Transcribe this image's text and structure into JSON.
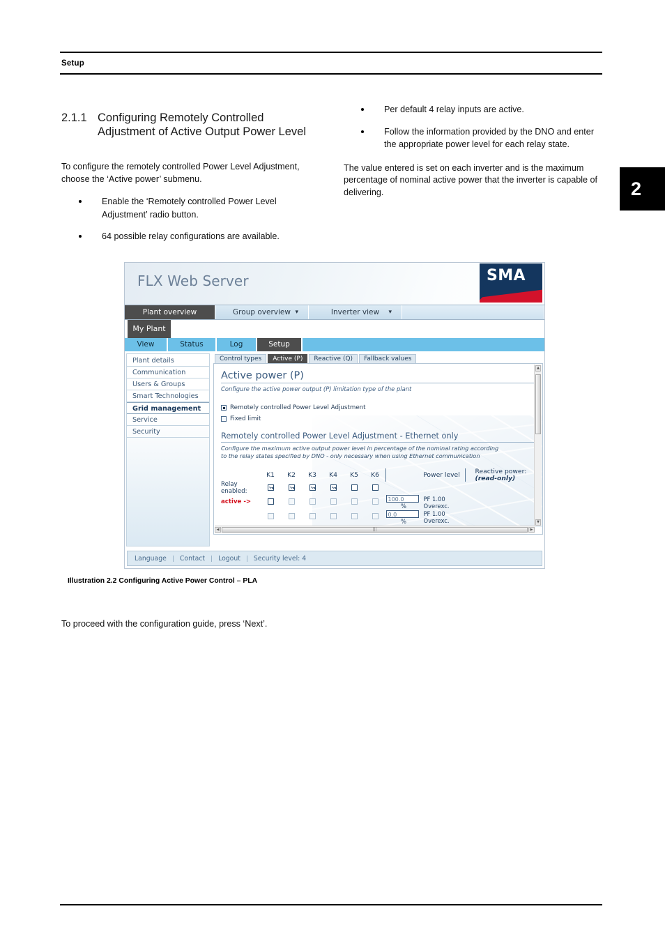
{
  "page": {
    "running_head": "Setup",
    "chapter_marker": "2"
  },
  "section": {
    "number": "2.1.1",
    "title": "Configuring Remotely Controlled Adjustment of Active Output Power Level"
  },
  "left_column": {
    "intro": "To configure the remotely controlled Power Level Adjustment, choose the ‘Active power’ submenu.",
    "bullets": [
      "Enable the ‘Remotely controlled Power Level Adjustment’ radio button.",
      "64 possible relay configurations are available."
    ]
  },
  "right_column": {
    "bullets": [
      "Per default 4 relay inputs are active.",
      "Follow the information provided by the DNO and enter the appropriate power level for each relay state."
    ],
    "paragraph": "The value entered is set on each inverter and is the maximum percentage of nominal active power that the inverter is capable of delivering."
  },
  "caption": "Illustration 2.2 Configuring Active Power Control – PLA",
  "trailing_text": "To proceed with the configuration guide, press ‘Next’.",
  "screenshot": {
    "app_title": "FLX Web Server",
    "logo_text": "SMA",
    "main_nav": [
      {
        "label": "Plant overview",
        "active": true,
        "caret": false
      },
      {
        "label": "Group overview",
        "active": false,
        "caret": true
      },
      {
        "label": "Inverter view",
        "active": false,
        "caret": true
      }
    ],
    "plant_tab": "My Plant",
    "sub_nav": [
      {
        "label": "View",
        "active": false
      },
      {
        "label": "Status",
        "active": false
      },
      {
        "label": "Log",
        "active": false
      },
      {
        "label": "Setup",
        "active": true
      }
    ],
    "sidebar": [
      {
        "label": "Plant details",
        "selected": false
      },
      {
        "label": "Communication",
        "selected": false
      },
      {
        "label": "Users & Groups",
        "selected": false
      },
      {
        "label": "Smart Technologies",
        "selected": false
      },
      {
        "label": "Grid management",
        "selected": true
      },
      {
        "label": "Service",
        "selected": false
      },
      {
        "label": "Security",
        "selected": false
      }
    ],
    "content_tabs": [
      {
        "label": "Control types",
        "active": false
      },
      {
        "label": "Active (P)",
        "active": true
      },
      {
        "label": "Reactive (Q)",
        "active": false
      },
      {
        "label": "Fallback values",
        "active": false
      }
    ],
    "panel": {
      "heading": "Active power (P)",
      "subheading": "Configure the active power output (P) limitation type of the plant",
      "options": [
        {
          "label": "Remotely controlled Power Level Adjustment",
          "selected": true
        },
        {
          "label": "Fixed limit",
          "selected": false
        }
      ],
      "section_heading": "Remotely controlled Power Level Adjustment - Ethernet only",
      "section_text": "Configure the maximum active output power level in percentage of the nominal rating according to the relay states specified by DNO - only necessary when using Ethernet communication"
    },
    "relay_table": {
      "relay_columns": [
        "K1",
        "K2",
        "K3",
        "K4",
        "K5",
        "K6"
      ],
      "power_level_header": "Power level",
      "reactive_power_header": "Reactive power:",
      "reactive_power_header_sub": "(read-only)",
      "row_labels": {
        "relay_enabled_line1": "Relay",
        "relay_enabled_line2": "enabled:",
        "active_arrow": "active ->"
      },
      "relay_enabled": [
        true,
        true,
        true,
        true,
        false,
        false
      ],
      "rows": [
        {
          "checks": [
            false,
            false,
            false,
            false,
            false,
            false
          ],
          "dim": [
            false,
            false,
            false,
            false,
            true,
            true
          ],
          "power_level": "100.0",
          "unit": "%",
          "reactive_power": "PF 1.00 Overexc."
        },
        {
          "checks": [
            true,
            false,
            false,
            false,
            false,
            false
          ],
          "dim": [
            true,
            true,
            true,
            true,
            true,
            true
          ],
          "power_level": "0.0",
          "unit": "%",
          "reactive_power": "PF 1.00 Overexc."
        }
      ]
    },
    "footer": [
      "Language",
      "Contact",
      "Logout",
      "Security level: 4"
    ]
  }
}
